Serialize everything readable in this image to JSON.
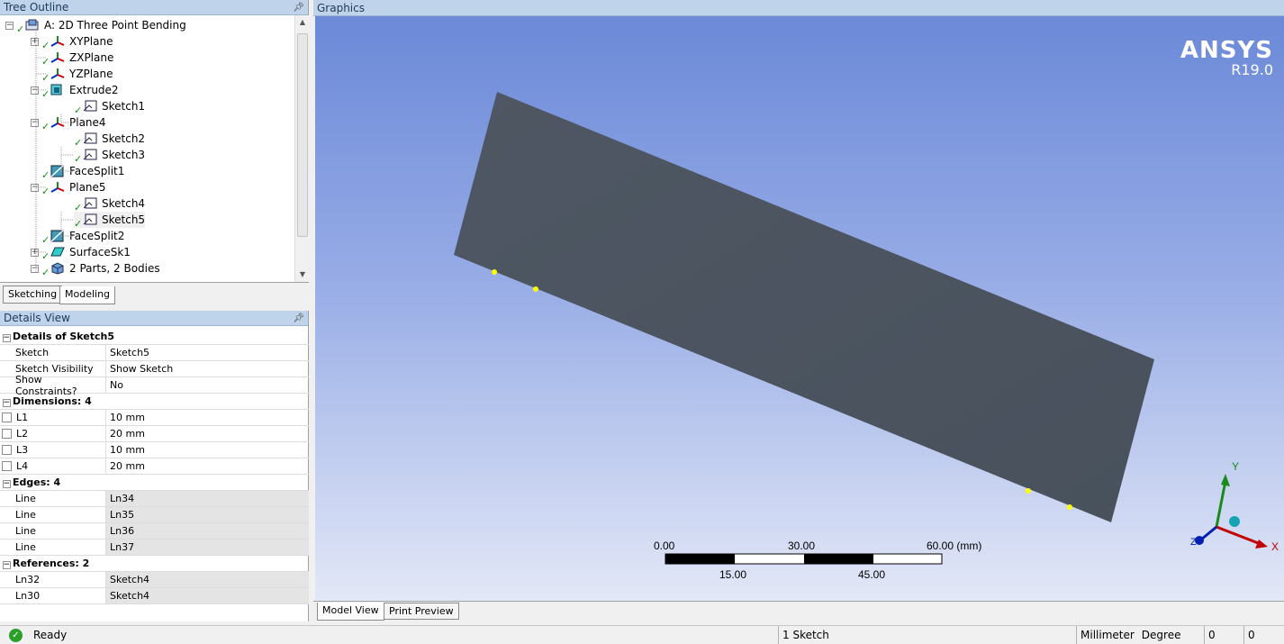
{
  "tree_outline": {
    "title": "Tree Outline",
    "items": [
      {
        "label": "A: 2D Three Point Bending",
        "icon": "geometry-icon"
      },
      {
        "label": "XYPlane",
        "icon": "plane-icon"
      },
      {
        "label": "ZXPlane",
        "icon": "plane-icon"
      },
      {
        "label": "YZPlane",
        "icon": "plane-icon"
      },
      {
        "label": "Extrude2",
        "icon": "extrude-icon"
      },
      {
        "label": "Sketch1",
        "icon": "sketch-icon"
      },
      {
        "label": "Plane4",
        "icon": "plane-icon"
      },
      {
        "label": "Sketch2",
        "icon": "sketch-icon"
      },
      {
        "label": "Sketch3",
        "icon": "sketch-icon"
      },
      {
        "label": "FaceSplit1",
        "icon": "facesplit-icon"
      },
      {
        "label": "Plane5",
        "icon": "plane-icon"
      },
      {
        "label": "Sketch4",
        "icon": "sketch-icon"
      },
      {
        "label": "Sketch5",
        "icon": "sketch-icon"
      },
      {
        "label": "FaceSplit2",
        "icon": "facesplit-icon"
      },
      {
        "label": "SurfaceSk1",
        "icon": "surface-icon"
      },
      {
        "label": "2 Parts, 2 Bodies",
        "icon": "parts-icon"
      }
    ],
    "tabs": [
      "Sketching",
      "Modeling"
    ]
  },
  "details_view": {
    "title": "Details View",
    "groups": [
      {
        "header": "Details of Sketch5",
        "rows": [
          {
            "name": "Sketch",
            "value": "Sketch5"
          },
          {
            "name": "Sketch Visibility",
            "value": "Show Sketch"
          },
          {
            "name": "Show Constraints?",
            "value": "No"
          }
        ]
      },
      {
        "header": "Dimensions: 4",
        "rows": [
          {
            "name": "L1",
            "value": "10 mm"
          },
          {
            "name": "L2",
            "value": "20 mm"
          },
          {
            "name": "L3",
            "value": "10 mm"
          },
          {
            "name": "L4",
            "value": "20 mm"
          }
        ]
      },
      {
        "header": "Edges: 4",
        "rows": [
          {
            "name": "Line",
            "value": "Ln34"
          },
          {
            "name": "Line",
            "value": "Ln35"
          },
          {
            "name": "Line",
            "value": "Ln36"
          },
          {
            "name": "Line",
            "value": "Ln37"
          }
        ]
      },
      {
        "header": "References: 2",
        "rows": [
          {
            "name": "Ln32",
            "value": "Sketch4"
          },
          {
            "name": "Ln30",
            "value": "Sketch4"
          }
        ]
      }
    ]
  },
  "graphics": {
    "title": "Graphics",
    "logo_brand": "ANSYS",
    "logo_version": "R19.0",
    "scale_bar": {
      "top_labels": [
        "0.00",
        "30.00",
        "60.00 (mm)"
      ],
      "bottom_labels": [
        "15.00",
        "45.00"
      ]
    },
    "triad": {
      "x": "X",
      "y": "Y",
      "z": "Z"
    },
    "tabs": [
      "Model View",
      "Print Preview"
    ]
  },
  "status_bar": {
    "state": "Ready",
    "selection": "1 Sketch",
    "length_unit": "Millimeter",
    "angle_unit": "Degree",
    "field1": "0",
    "field2": "0"
  },
  "colors": {
    "body_fill": "#4b5460",
    "point_marker": "#ffff00",
    "panel_header": "#bfd3ea"
  }
}
